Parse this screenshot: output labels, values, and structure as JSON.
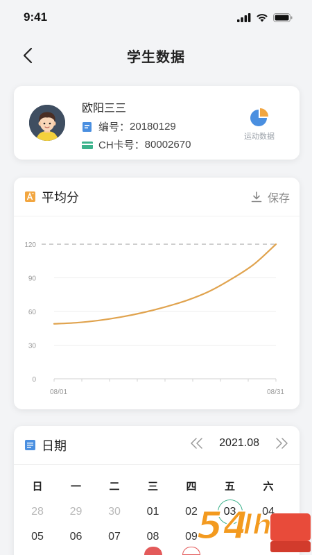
{
  "status_bar": {
    "time": "9:41"
  },
  "nav": {
    "title": "学生数据"
  },
  "student": {
    "name": "欧阳三三",
    "id_label": "编号：",
    "id_value": "20180129",
    "card_label": "CH卡号：",
    "card_value": "80002670",
    "sport_data_label": "运动数据"
  },
  "avg_section": {
    "title": "平均分",
    "save_label": "保存"
  },
  "chart_data": {
    "type": "line",
    "x_ticks": [
      "08/01",
      "08/31"
    ],
    "y_ticks": [
      "120",
      "90",
      "60",
      "30",
      "0"
    ],
    "ylim": [
      0,
      120
    ],
    "x": [
      1,
      4,
      7,
      10,
      13,
      16,
      19,
      22,
      25,
      28,
      31
    ],
    "series": [
      {
        "values": [
          49,
          50,
          52,
          55,
          59,
          64,
          70,
          78,
          89,
          102,
          120
        ]
      }
    ],
    "reference_line": 120,
    "line_color": "#e0a34e",
    "reference_color": "#b0b0b0",
    "grid": true
  },
  "calendar": {
    "title": "日期",
    "month": "2021.08",
    "weekdays": [
      "日",
      "一",
      "二",
      "三",
      "四",
      "五",
      "六"
    ],
    "rows": [
      [
        "28",
        "29",
        "30",
        "01",
        "02",
        "03",
        "04"
      ],
      [
        "05",
        "06",
        "07",
        "08",
        "09",
        "",
        ""
      ]
    ],
    "muted": [
      "28",
      "29",
      "30"
    ],
    "today": "03",
    "accent": "#3bb28b",
    "event_color": "#e35a5a"
  }
}
